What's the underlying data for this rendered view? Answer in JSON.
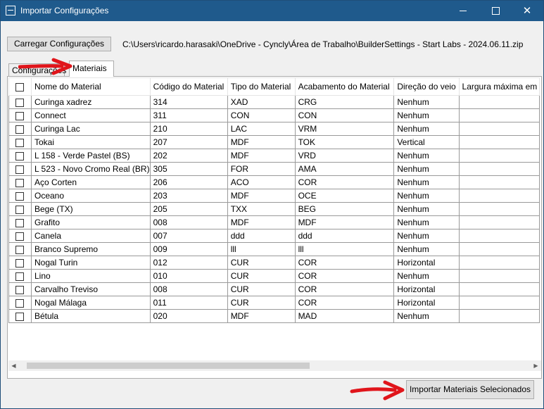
{
  "window": {
    "title": "Importar Configurações",
    "minimize_icon": "minimize-icon",
    "maximize_icon": "maximize-icon",
    "close_icon": "close-icon"
  },
  "toolbar": {
    "load_label": "Carregar Configurações",
    "path": "C:\\Users\\ricardo.harasaki\\OneDrive - Cyncly\\Área de Trabalho\\BuilderSettings - Start Labs - 2024.06.11.zip"
  },
  "tabs": [
    {
      "label": "Configurações"
    },
    {
      "label": "Materiais"
    }
  ],
  "table": {
    "columns": [
      "",
      "Nome do Material",
      "Código do Material",
      "Tipo do Material",
      "Acabamento do Material",
      "Direção do veio",
      "Largura máxima em"
    ],
    "rows": [
      [
        "Curinga xadrez",
        "314",
        "XAD",
        "CRG",
        "Nenhum"
      ],
      [
        "Connect",
        "311",
        "CON",
        "CON",
        "Nenhum"
      ],
      [
        "Curinga Lac",
        "210",
        "LAC",
        "VRM",
        "Nenhum"
      ],
      [
        "Tokai",
        "207",
        "MDF",
        "TOK",
        "Vertical"
      ],
      [
        "L 158 - Verde Pastel (BS)",
        "202",
        "MDF",
        "VRD",
        "Nenhum"
      ],
      [
        "L 523 - Novo Cromo Real (BR)",
        "305",
        "FOR",
        "AMA",
        "Nenhum"
      ],
      [
        "Aço Corten",
        "206",
        "ACO",
        "COR",
        "Nenhum"
      ],
      [
        "Oceano",
        "203",
        "MDF",
        "OCE",
        "Nenhum"
      ],
      [
        "Bege (TX)",
        "205",
        "TXX",
        "BEG",
        "Nenhum"
      ],
      [
        "Grafito",
        "008",
        "MDF",
        "MDF",
        "Nenhum"
      ],
      [
        "Canela",
        "007",
        "ddd",
        "ddd",
        "Nenhum"
      ],
      [
        "Branco Supremo",
        "009",
        "lll",
        "lll",
        "Nenhum"
      ],
      [
        "Nogal Turin",
        "012",
        "CUR",
        "COR",
        "Horizontal"
      ],
      [
        "Lino",
        "010",
        "CUR",
        "COR",
        "Nenhum"
      ],
      [
        "Carvalho Treviso",
        "008",
        "CUR",
        "COR",
        "Horizontal"
      ],
      [
        "Nogal Málaga",
        "011",
        "CUR",
        "COR",
        "Horizontal"
      ],
      [
        "Bétula",
        "020",
        "MDF",
        "MAD",
        "Nenhum"
      ]
    ]
  },
  "footer": {
    "import_label": "Importar Materiais Selecionados"
  },
  "colors": {
    "titlebar": "#1f5a8c",
    "annotation_arrow": "#e0151b"
  }
}
